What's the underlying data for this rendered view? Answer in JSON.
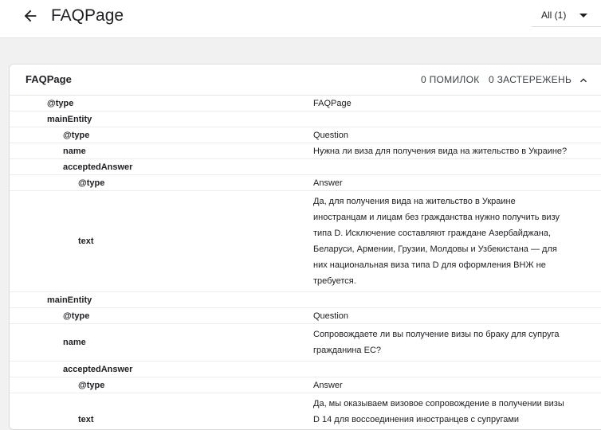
{
  "header": {
    "title": "FAQPage",
    "filter_label": "All (1)"
  },
  "card": {
    "title": "FAQPage",
    "errors": "0 ПОМИЛОК",
    "warnings": "0 ЗАСТЕРЕЖЕНЬ"
  },
  "rows": [
    {
      "key": "@type",
      "value": "FAQPage",
      "level": 1
    },
    {
      "key": "mainEntity",
      "value": "",
      "level": 1
    },
    {
      "key": "@type",
      "value": "Question",
      "level": 2
    },
    {
      "key": "name",
      "value": "Нужна ли виза для получения вида на жительство в Украине?",
      "level": 2
    },
    {
      "key": "acceptedAnswer",
      "value": "",
      "level": 2
    },
    {
      "key": "@type",
      "value": "Answer",
      "level": 3
    },
    {
      "key": "text",
      "value": "Да, для получения вида на жительство в Украине иностранцам и лицам без гражданства нужно получить визу типа D. Исключение составляют граждане Азербайджана, Беларуси, Армении, Грузии, Молдовы и Узбекистана — для них национальная виза типа D для оформления ВНЖ не требуется.",
      "level": 3
    },
    {
      "key": "mainEntity",
      "value": "",
      "level": 1
    },
    {
      "key": "@type",
      "value": "Question",
      "level": 2
    },
    {
      "key": "name",
      "value": "Сопровождаете ли вы получение визы по браку для супруга гражданина ЕС?",
      "level": 2
    },
    {
      "key": "acceptedAnswer",
      "value": "",
      "level": 2
    },
    {
      "key": "@type",
      "value": "Answer",
      "level": 3
    },
    {
      "key": "text",
      "value": "Да, мы оказываем визовое сопровождение в получении визы D 14 для воссоединения иностранцев с супругами гражданами Украины.",
      "level": 3
    }
  ],
  "icons": {
    "back": "arrow-left",
    "dropdown": "triangle-down",
    "collapse": "chevron-up"
  }
}
